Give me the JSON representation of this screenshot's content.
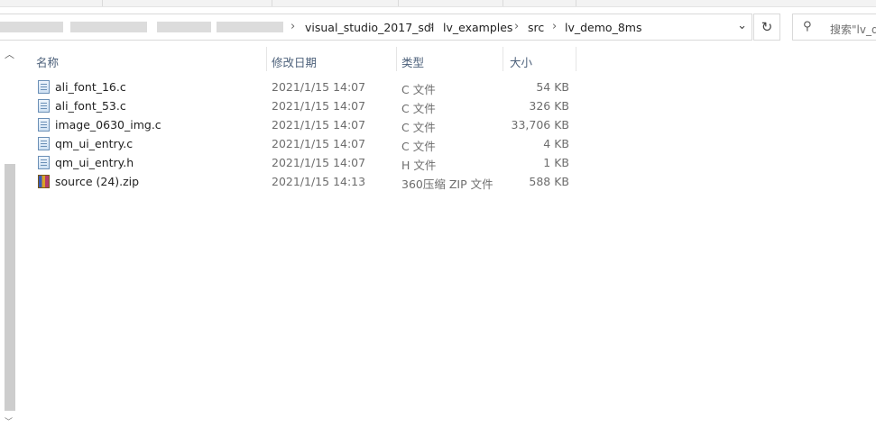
{
  "breadcrumb": {
    "items": [
      "visual_studio_2017_sdl",
      "lv_examples",
      "src",
      "lv_demo_8ms"
    ]
  },
  "search": {
    "placeholder": "搜索\"lv_d"
  },
  "columns": {
    "name": "名称",
    "modified": "修改日期",
    "type": "类型",
    "size": "大小"
  },
  "files": [
    {
      "name": "ali_font_16.c",
      "modified": "2021/1/15 14:07",
      "type": "C 文件",
      "size": "54 KB",
      "icon": "c-file-icon"
    },
    {
      "name": "ali_font_53.c",
      "modified": "2021/1/15 14:07",
      "type": "C 文件",
      "size": "326 KB",
      "icon": "c-file-icon"
    },
    {
      "name": "image_0630_img.c",
      "modified": "2021/1/15 14:07",
      "type": "C 文件",
      "size": "33,706 KB",
      "icon": "c-file-icon"
    },
    {
      "name": "qm_ui_entry.c",
      "modified": "2021/1/15 14:07",
      "type": "C 文件",
      "size": "4 KB",
      "icon": "c-file-icon"
    },
    {
      "name": "qm_ui_entry.h",
      "modified": "2021/1/15 14:07",
      "type": "H 文件",
      "size": "1 KB",
      "icon": "h-file-icon"
    },
    {
      "name": "source (24).zip",
      "modified": "2021/1/15 14:13",
      "type": "360压缩 ZIP 文件",
      "size": "588 KB",
      "icon": "zip-archive-icon"
    }
  ]
}
